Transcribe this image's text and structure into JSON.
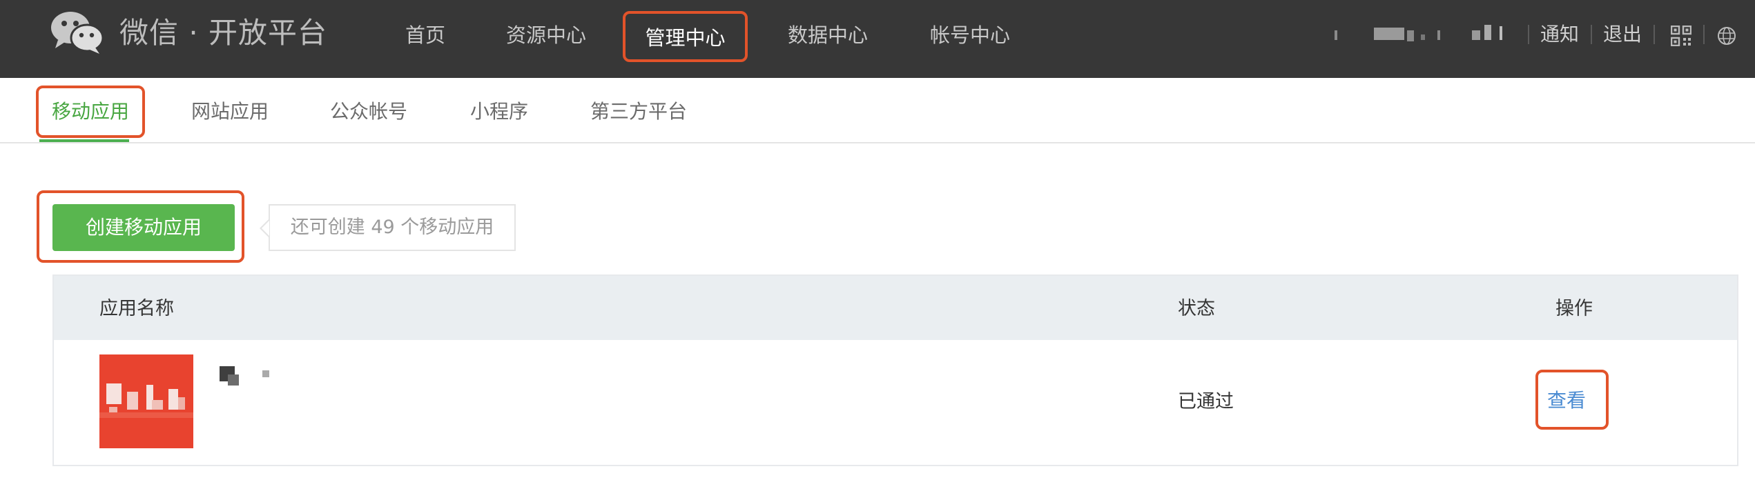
{
  "header": {
    "brand": "微信 · 开放平台",
    "nav": [
      {
        "label": "首页"
      },
      {
        "label": "资源中心"
      },
      {
        "label": "管理中心"
      },
      {
        "label": "数据中心"
      },
      {
        "label": "帐号中心"
      }
    ],
    "notify_label": "通知",
    "logout_label": "退出"
  },
  "subnav": {
    "tabs": [
      {
        "label": "移动应用"
      },
      {
        "label": "网站应用"
      },
      {
        "label": "公众帐号"
      },
      {
        "label": "小程序"
      },
      {
        "label": "第三方平台"
      }
    ]
  },
  "create": {
    "button_label": "创建移动应用",
    "tip": "还可创建 49 个移动应用"
  },
  "table": {
    "columns": [
      "应用名称",
      "状态",
      "操作"
    ],
    "rows": [
      {
        "status": "已通过",
        "action": "查看"
      }
    ]
  },
  "colors": {
    "header_bg": "#373737",
    "accent_green": "#59b64f",
    "highlight_red": "#e2532a",
    "link_blue": "#4a8bd2"
  }
}
